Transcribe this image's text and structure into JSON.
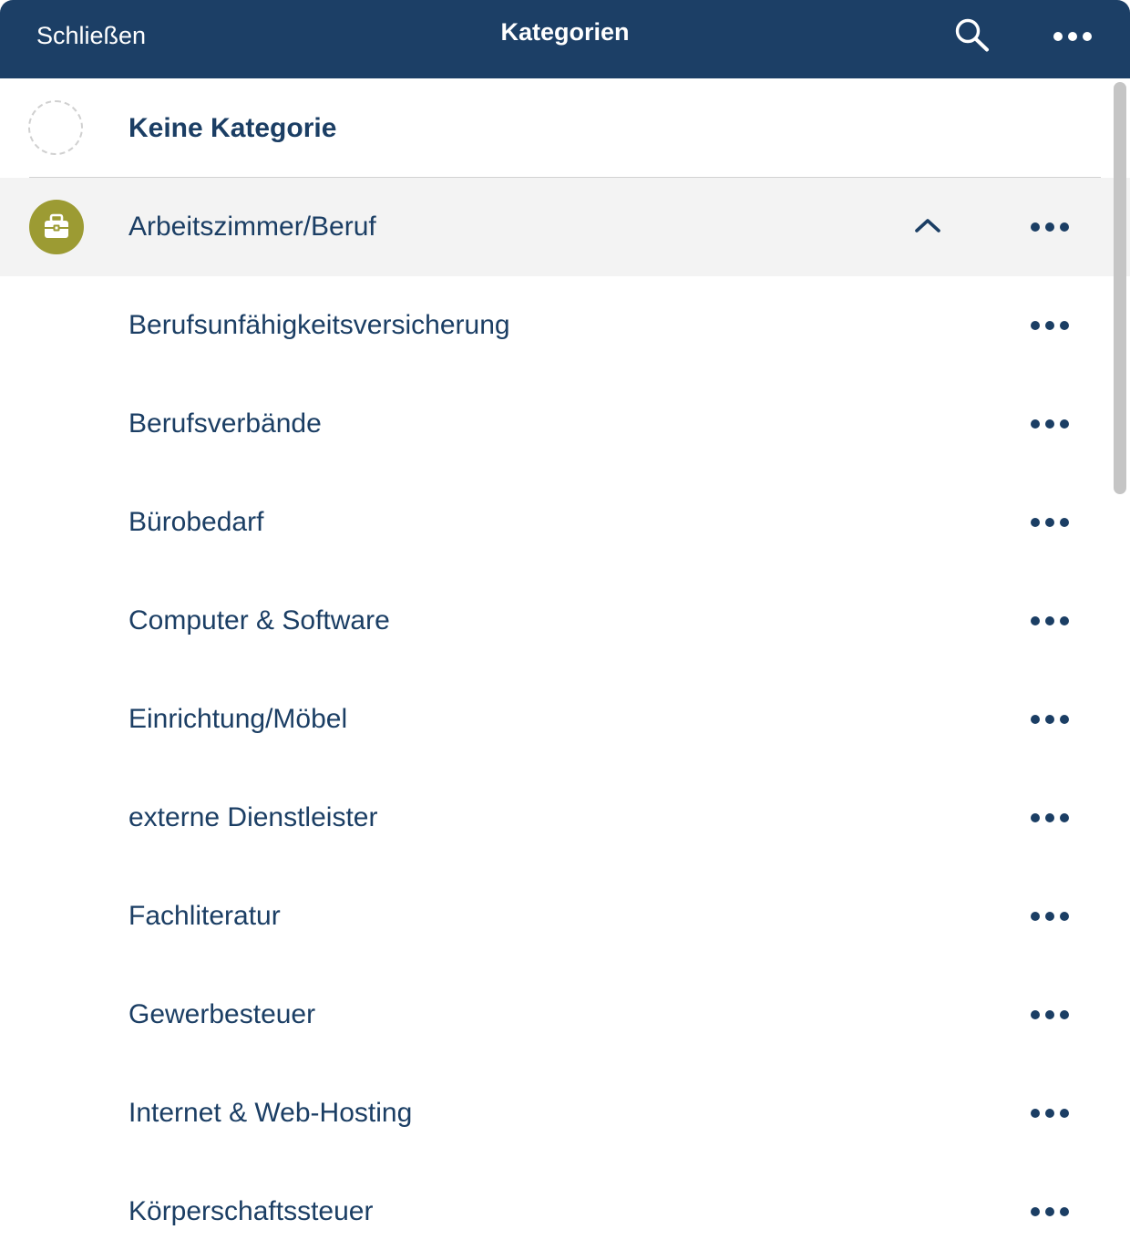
{
  "header": {
    "close_label": "Schließen",
    "title": "Kategorien",
    "search_icon": "search-icon",
    "more_icon": "ellipsis-icon"
  },
  "colors": {
    "header_bg": "#1c3f66",
    "text": "#1b3e64",
    "parent_icon_bg": "#9c9b33",
    "selected_row_bg": "#f3f3f3"
  },
  "no_category": {
    "label": "Keine Kategorie",
    "icon": "empty-circle-icon"
  },
  "parent": {
    "label": "Arbeitszimmer/Beruf",
    "icon": "briefcase-icon",
    "expanded": true,
    "collapse_icon": "chevron-up-icon",
    "more_icon": "ellipsis-icon"
  },
  "subcategories": [
    "Berufsunfähigkeitsversicherung",
    "Berufsverbände",
    "Bürobedarf",
    "Computer & Software",
    "Einrichtung/Möbel",
    "externe Dienstleister",
    "Fachliteratur",
    "Gewerbesteuer",
    "Internet & Web-Hosting",
    "Körperschaftssteuer"
  ]
}
